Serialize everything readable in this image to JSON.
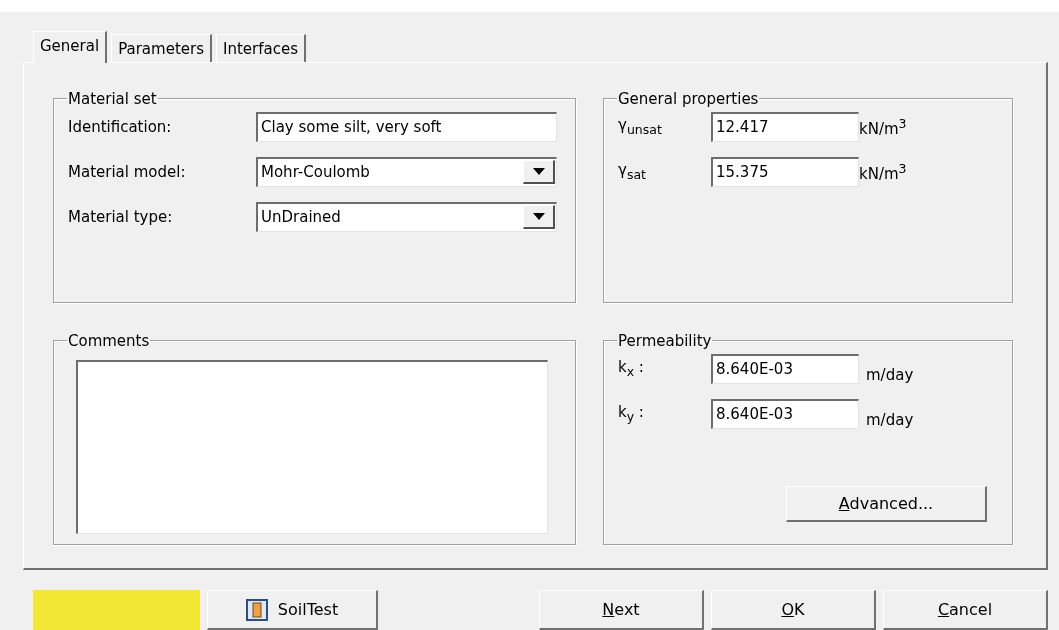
{
  "tabs": [
    {
      "label": "General",
      "selected": true
    },
    {
      "label": "Parameters",
      "selected": false
    },
    {
      "label": "Interfaces",
      "selected": false
    }
  ],
  "material_set": {
    "title": "Material set",
    "fields": [
      {
        "kind": "text",
        "label": "Identification:",
        "value": "Clay some silt, very soft"
      },
      {
        "kind": "combo",
        "label": "Material model:",
        "value": "Mohr-Coulomb"
      },
      {
        "kind": "combo",
        "label": "Material type:",
        "value": "UnDrained"
      }
    ]
  },
  "general_properties": {
    "title": "General properties",
    "rows": [
      {
        "label": "γ$_{unsat}$",
        "value": "12.417",
        "unit": "kN/m$^{3}$"
      },
      {
        "label": "γ$_{sat}$",
        "value": "15.375",
        "unit": "kN/m$^{3}$"
      }
    ]
  },
  "comments": {
    "title": "Comments"
  },
  "permeability": {
    "title": "Permeability",
    "rows": [
      {
        "label": "k$_{x}$ :",
        "value": "8.640E-03",
        "unit": "m/day"
      },
      {
        "label": "k$_{y}$ :",
        "value": "8.640E-03",
        "unit": "m/day"
      }
    ],
    "button": {
      "accel": "A",
      "rest": "dvanced..."
    }
  },
  "buttons": [
    {
      "kind": "color",
      "color": "#f2e834"
    },
    {
      "kind": "icon",
      "label": "SoilTest"
    },
    {
      "kind": "plain",
      "accel": "N",
      "rest": "ext"
    },
    {
      "kind": "plain",
      "accel": "O",
      "rest": "K"
    },
    {
      "kind": "plain",
      "accel": "C",
      "rest": "ancel"
    }
  ]
}
